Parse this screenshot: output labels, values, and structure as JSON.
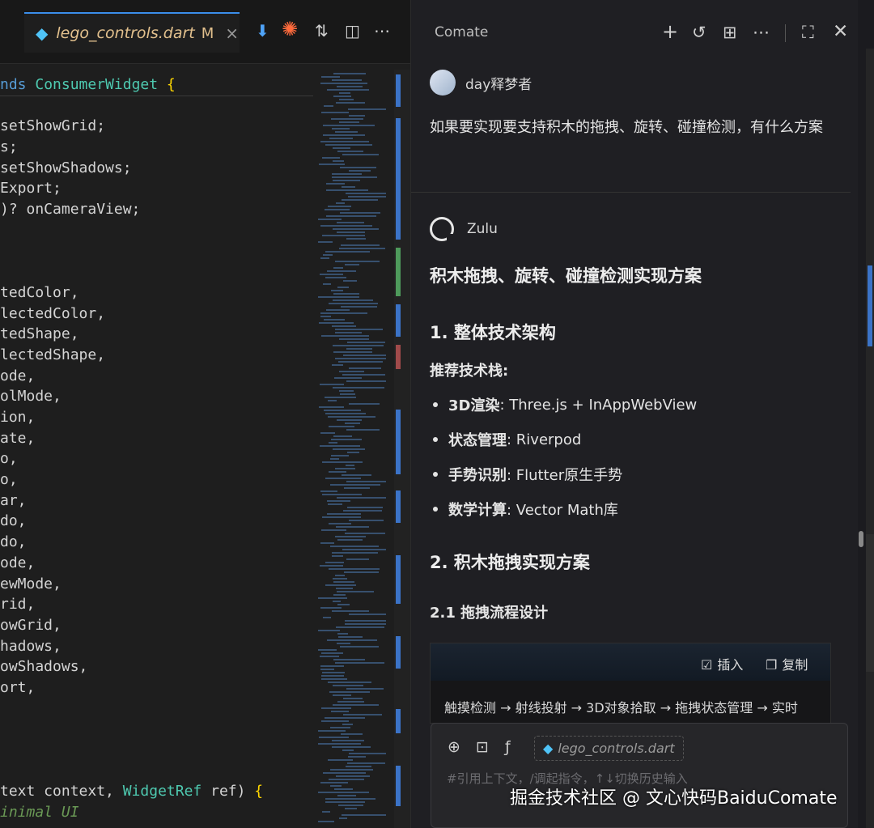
{
  "editor": {
    "tab": {
      "filename": "lego_controls.dart",
      "modified_flag": "M",
      "close_glyph": "×"
    },
    "tab_icons": [
      "pin-icon",
      "comate-spark-icon",
      "compare-icon",
      "split-editor-icon",
      "more-icon"
    ],
    "code_lines": [
      {
        "parts": [
          {
            "t": "nds ",
            "c": "kw"
          },
          {
            "t": "ConsumerWidget",
            "c": "cls"
          },
          {
            "t": " ",
            "c": ""
          },
          {
            "t": "{",
            "c": "br"
          }
        ]
      },
      {
        "parts": [
          {
            "t": "",
            "c": ""
          }
        ]
      },
      {
        "parts": [
          {
            "t": "setShowGrid;",
            "c": ""
          }
        ]
      },
      {
        "parts": [
          {
            "t": "s;",
            "c": ""
          }
        ]
      },
      {
        "parts": [
          {
            "t": "setShowShadows;",
            "c": ""
          }
        ]
      },
      {
        "parts": [
          {
            "t": "Export;",
            "c": ""
          }
        ]
      },
      {
        "parts": [
          {
            "t": ")? onCameraView;",
            "c": ""
          }
        ]
      },
      {
        "parts": [
          {
            "t": "",
            "c": ""
          }
        ]
      },
      {
        "parts": [
          {
            "t": "",
            "c": ""
          }
        ]
      },
      {
        "parts": [
          {
            "t": "",
            "c": ""
          }
        ]
      },
      {
        "parts": [
          {
            "t": "tedColor,",
            "c": ""
          }
        ]
      },
      {
        "parts": [
          {
            "t": "lectedColor,",
            "c": ""
          }
        ]
      },
      {
        "parts": [
          {
            "t": "tedShape,",
            "c": ""
          }
        ]
      },
      {
        "parts": [
          {
            "t": "lectedShape,",
            "c": ""
          }
        ]
      },
      {
        "parts": [
          {
            "t": "ode,",
            "c": ""
          }
        ]
      },
      {
        "parts": [
          {
            "t": "olMode,",
            "c": ""
          }
        ]
      },
      {
        "parts": [
          {
            "t": "ion,",
            "c": ""
          }
        ]
      },
      {
        "parts": [
          {
            "t": "ate,",
            "c": ""
          }
        ]
      },
      {
        "parts": [
          {
            "t": "o,",
            "c": ""
          }
        ]
      },
      {
        "parts": [
          {
            "t": "o,",
            "c": ""
          }
        ]
      },
      {
        "parts": [
          {
            "t": "ar,",
            "c": ""
          }
        ]
      },
      {
        "parts": [
          {
            "t": "do,",
            "c": ""
          }
        ]
      },
      {
        "parts": [
          {
            "t": "do,",
            "c": ""
          }
        ]
      },
      {
        "parts": [
          {
            "t": "ode,",
            "c": ""
          }
        ]
      },
      {
        "parts": [
          {
            "t": "ewMode,",
            "c": ""
          }
        ]
      },
      {
        "parts": [
          {
            "t": "rid,",
            "c": ""
          }
        ]
      },
      {
        "parts": [
          {
            "t": "owGrid,",
            "c": ""
          }
        ]
      },
      {
        "parts": [
          {
            "t": "hadows,",
            "c": ""
          }
        ]
      },
      {
        "parts": [
          {
            "t": "owShadows,",
            "c": ""
          }
        ]
      },
      {
        "parts": [
          {
            "t": "ort,",
            "c": ""
          }
        ]
      },
      {
        "parts": [
          {
            "t": "",
            "c": ""
          }
        ]
      },
      {
        "parts": [
          {
            "t": "",
            "c": ""
          }
        ]
      },
      {
        "parts": [
          {
            "t": "",
            "c": ""
          }
        ]
      },
      {
        "parts": [
          {
            "t": "",
            "c": ""
          }
        ]
      },
      {
        "parts": [
          {
            "t": "text context, ",
            "c": ""
          },
          {
            "t": "WidgetRef",
            "c": "cls"
          },
          {
            "t": " ref) ",
            "c": ""
          },
          {
            "t": "{",
            "c": "br"
          }
        ]
      },
      {
        "parts": [
          {
            "t": "inimal UI",
            "c": "cm"
          }
        ]
      }
    ]
  },
  "panel": {
    "title": "Comate",
    "header_icons": [
      "plus-icon",
      "history-icon",
      "layout-icon",
      "more-icon",
      "maximize-icon",
      "close-icon"
    ],
    "user": {
      "name": "day释梦者",
      "question": "如果要实现要支持积木的拖拽、旋转、碰撞检测，有什么方案"
    },
    "bot": {
      "name": "Zulu"
    },
    "answer": {
      "title": "积木拖拽、旋转、碰撞检测实现方案",
      "section1": "1. 整体技术架构",
      "stack_label": "推荐技术栈:",
      "stack": [
        {
          "key": "3D渲染",
          "value": ": Three.js + InAppWebView"
        },
        {
          "key": "状态管理",
          "value": ": Riverpod"
        },
        {
          "key": "手势识别",
          "value": ": Flutter原生手势"
        },
        {
          "key": "数学计算",
          "value": ": Vector Math库"
        }
      ],
      "section2": "2. 积木拖拽实现方案",
      "section21": "2.1 拖拽流程设计",
      "codebox": {
        "insert_label": "插入",
        "copy_label": "复制",
        "flow": "触摸检测 → 射线投射 → 3D对象拾取 → 拖拽状态管理 → 实时"
      }
    },
    "input": {
      "context_chip": "lego_controls.dart",
      "placeholder": "#引用上下文，/调起指令，↑↓切换历史输入"
    }
  },
  "watermark": "掘金技术社区 @ 文心快码BaiduComate"
}
